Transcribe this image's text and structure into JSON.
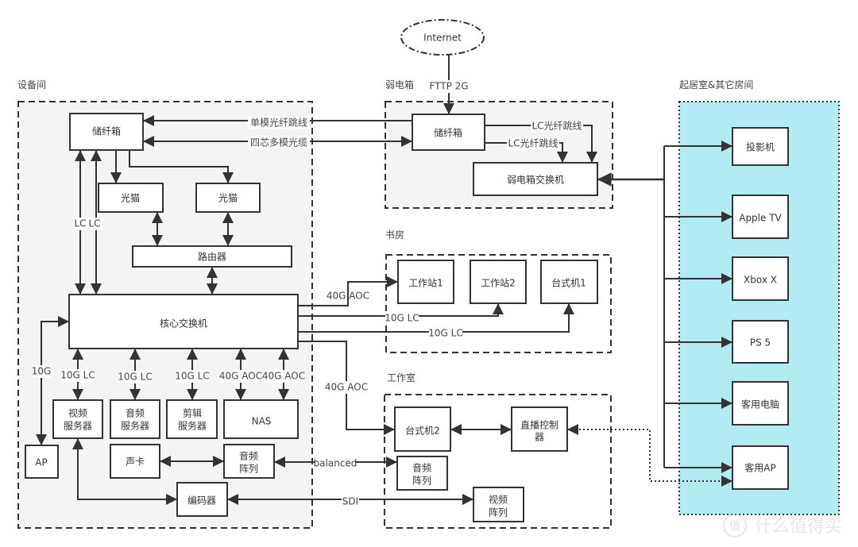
{
  "colors": {
    "room_fill": "#f4f4f4",
    "living_fill": "#b2ebf2",
    "line": "#333333"
  },
  "groups": {
    "equipment_room": "设备间",
    "weak_box": "弱电箱",
    "study": "书房",
    "studio": "工作室",
    "living": "起居室&其它房间"
  },
  "nodes": {
    "internet": "Internet",
    "fiber_box_left": "储纤箱",
    "modem1": "光猫",
    "modem2": "光猫",
    "router": "路由器",
    "core_switch": "核心交换机",
    "video_server": [
      "视频",
      "服务器"
    ],
    "audio_server": [
      "音频",
      "服务器"
    ],
    "edit_server": [
      "剪辑",
      "服务器"
    ],
    "nas": "NAS",
    "ap": "AP",
    "sound_card": "声卡",
    "audio_matrix_left": [
      "音频",
      "阵列"
    ],
    "encoder": "编码器",
    "fiber_box_right": "储纤箱",
    "weak_switch": "弱电箱交换机",
    "workstation1": "工作站1",
    "workstation2": "工作站2",
    "desktop1": "台式机1",
    "desktop2": "台式机2",
    "live_controller": [
      "直播控制",
      "器"
    ],
    "audio_matrix_studio": [
      "音频",
      "阵列"
    ],
    "video_matrix": [
      "视频",
      "阵列"
    ],
    "projector": "投影机",
    "apple_tv": "Apple TV",
    "xbox": "Xbox X",
    "ps5": "PS 5",
    "guest_pc": "客用电脑",
    "guest_ap": "客用AP"
  },
  "edges": {
    "single_mode": "单模光纤跳线",
    "multi_mode": "四芯多模光缆",
    "lc1": "LC",
    "lc2": "LC",
    "ap_link": "10G",
    "video_server_link": "10G LC",
    "audio_server_link": "10G LC",
    "edit_server_link": "10G LC",
    "nas_link1": "40G AOC",
    "nas_link2": "40G AOC",
    "ws1_link": "40G AOC",
    "ws2_link": "10G LC",
    "desktop1_link": "10G LC",
    "desktop2_link": "40G AOC",
    "balanced": "balanced",
    "sdi": "SDI",
    "fttp": "FTTP 2G",
    "lc_patch1": "LC光纤跳线",
    "lc_patch2": "LC光纤跳线"
  },
  "watermark": "值 什么值得买"
}
